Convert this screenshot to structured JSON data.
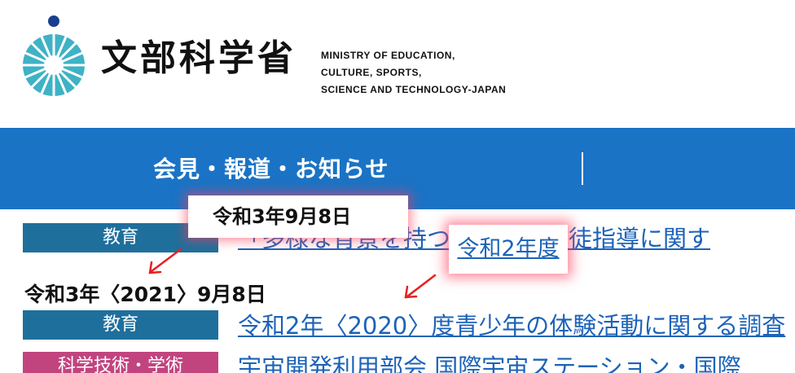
{
  "header": {
    "logo_kanji": "文部科学省",
    "logo_en_lines": [
      "MINISTRY OF EDUCATION,",
      "CULTURE, SPORTS,",
      "SCIENCE AND TECHNOLOGY-JAPAN"
    ]
  },
  "nav": {
    "item_label": "会見・報道・お知らせ"
  },
  "tooltips": {
    "date": "令和3年9月8日",
    "year": "令和2年度"
  },
  "news": {
    "items": [
      {
        "category": "教育",
        "title": "「多様な背景を持つ生徒への生徒指導に関す"
      },
      {
        "category": "教育",
        "title": "令和2年〈2020〉度青少年の体験活動に関する調査"
      },
      {
        "category": "科学技術・学術",
        "title": "宇宙開発利用部会 国際宇宙ステーション・国際"
      }
    ],
    "date_heading": "令和3年〈2021〉9月8日"
  },
  "colors": {
    "nav_blue": "#1b73c5",
    "edu_badge": "#1f6f9c",
    "sci_badge": "#c2447f",
    "link_blue": "#1c63b8",
    "logo_teal": "#3fb2c5",
    "logo_navy": "#18408f"
  }
}
